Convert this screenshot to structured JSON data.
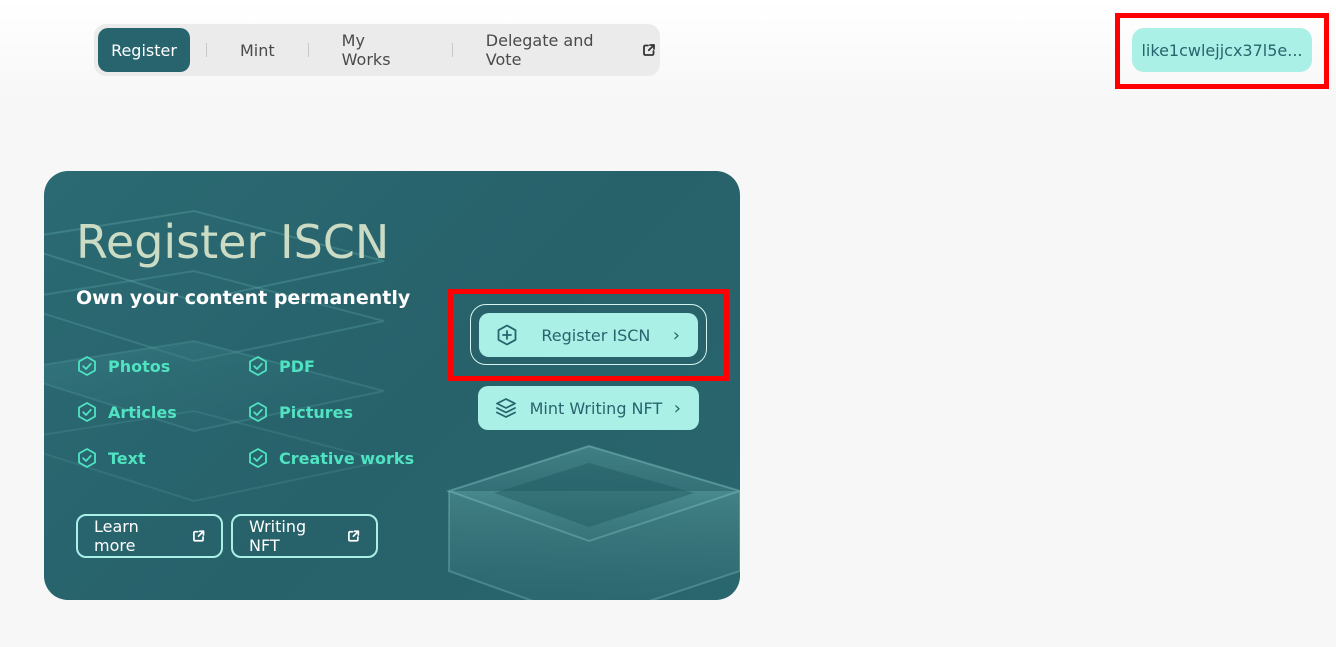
{
  "nav": {
    "items": [
      {
        "label": "Register",
        "active": true
      },
      {
        "label": "Mint",
        "active": false
      },
      {
        "label": "My Works",
        "active": false
      },
      {
        "label": "Delegate and Vote",
        "active": false,
        "external": true
      }
    ]
  },
  "wallet": {
    "address": "like1cwlejjcx37l5e..."
  },
  "card": {
    "title": "Register ISCN",
    "subtitle": "Own your content permanently",
    "features": [
      "Photos",
      "PDF",
      "Articles",
      "Pictures",
      "Text",
      "Creative works"
    ],
    "buttons": {
      "learn_more": "Learn more",
      "writing_nft": "Writing NFT",
      "register_iscn": "Register ISCN",
      "mint_writing_nft": "Mint Writing NFT"
    }
  },
  "colors": {
    "brand_dark": "#28646e",
    "brand_light": "#aaf0e6",
    "feature_text": "#50e3c2",
    "highlight": "#ff0000"
  }
}
